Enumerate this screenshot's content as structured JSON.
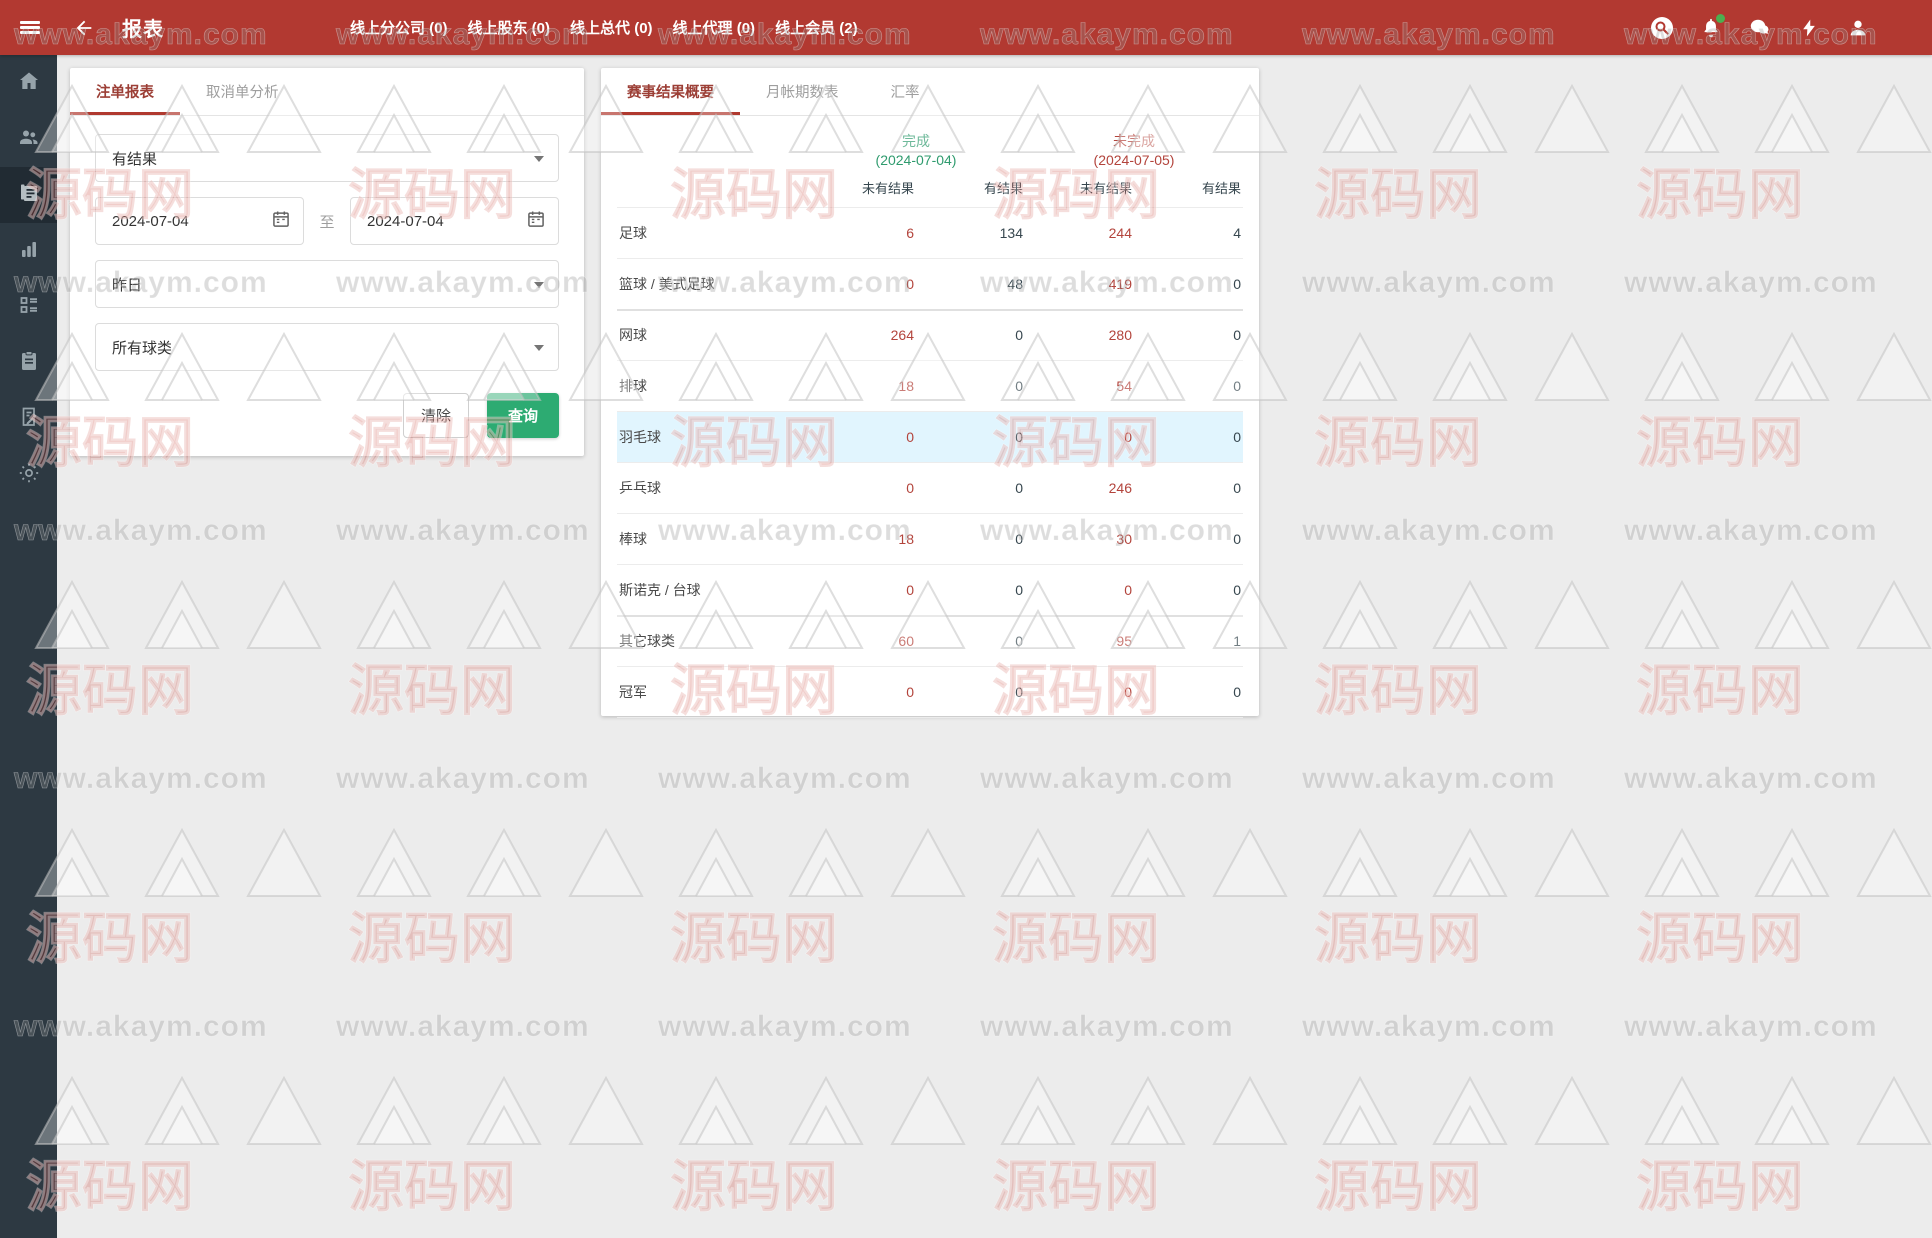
{
  "topbar": {
    "title": "报表",
    "breadcrumbs": [
      "线上分公司 (0)",
      "线上股东 (0)",
      "线上总代 (0)",
      "线上代理 (0)",
      "线上会员 (2)"
    ]
  },
  "sidebar": {
    "items": [
      {
        "icon": "home-icon"
      },
      {
        "icon": "members-icon"
      },
      {
        "icon": "reports-icon",
        "active": true
      },
      {
        "icon": "statistics-icon"
      },
      {
        "icon": "management-icon"
      },
      {
        "icon": "records-icon"
      },
      {
        "icon": "audit-icon"
      },
      {
        "icon": "settings-gear-icon"
      }
    ]
  },
  "filter_panel": {
    "tabs": [
      {
        "label": "注单报表",
        "active": true
      },
      {
        "label": "取消单分析",
        "active": false
      }
    ],
    "result_status": "有结果",
    "date_from": "2024-07-04",
    "to_label": "至",
    "date_to": "2024-07-04",
    "quick_period": "昨日",
    "sport_filter": "所有球类",
    "buttons": {
      "clear": "清除",
      "search": "查询"
    }
  },
  "report_panel": {
    "tabs": [
      {
        "label": "赛事结果概要",
        "active": true
      },
      {
        "label": "月帐期数表",
        "active": false
      },
      {
        "label": "汇率",
        "active": false
      }
    ],
    "column_groups": [
      {
        "title": "完成",
        "date": "(2024-07-04)"
      },
      {
        "title": "未完成",
        "date": "(2024-07-05)"
      }
    ],
    "sub_headers": [
      "未有结果",
      "有结果",
      "未有结果",
      "有结果"
    ],
    "rows": [
      {
        "sport": "足球",
        "values": [
          6,
          134,
          244,
          4
        ]
      },
      {
        "sport": "篮球 / 美式足球",
        "values": [
          0,
          48,
          419,
          0
        ]
      },
      {
        "sport": "网球",
        "values": [
          264,
          0,
          280,
          0
        ]
      },
      {
        "sport": "排球",
        "values": [
          18,
          0,
          54,
          0
        ]
      },
      {
        "sport": "羽毛球",
        "values": [
          0,
          0,
          0,
          0
        ]
      },
      {
        "sport": "乒乓球",
        "values": [
          0,
          0,
          246,
          0
        ]
      },
      {
        "sport": "棒球",
        "values": [
          18,
          0,
          30,
          0
        ]
      },
      {
        "sport": "斯诺克 / 台球",
        "values": [
          0,
          0,
          0,
          0
        ]
      },
      {
        "sport": "其它球类",
        "values": [
          60,
          0,
          95,
          1
        ]
      },
      {
        "sport": "冠军",
        "values": [
          0,
          0,
          0,
          0
        ]
      }
    ]
  },
  "watermark": {
    "url_text": "www.akaym.com",
    "brand_text": "源码网"
  },
  "colors": {
    "topbar": "#b23931",
    "sidebar": "#2d3942",
    "accent_red": "#b3443c",
    "accent_green": "#2f9b6e",
    "button_green": "#2dab72",
    "tab_active": "#9c3f36",
    "row_highlight": "#e1f5fe",
    "notification_dot": "#4caf50"
  }
}
